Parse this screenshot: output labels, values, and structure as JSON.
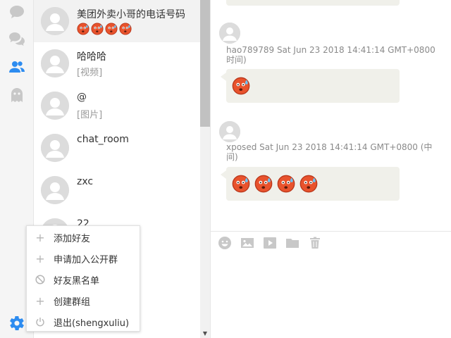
{
  "colors": {
    "accent": "#2d8cf0",
    "rail_icon": "#c8c8c8",
    "active_item_bg": "#f2f2f2",
    "bubble_bg": "#f0f0ea",
    "gear": "#2d8cf0"
  },
  "rail": {
    "icons": [
      "chat-bubble-icon",
      "group-chat-icon",
      "contacts-icon",
      "ghost-icon"
    ],
    "settings_icon": "gear-icon"
  },
  "conversations": [
    {
      "name": "美团外卖小哥的电话号码",
      "preview": "",
      "emoji_count": 4,
      "active": true
    },
    {
      "name": "哈哈哈",
      "preview": "[视频]"
    },
    {
      "name": "@",
      "preview": "[图片]"
    },
    {
      "name": "chat_room",
      "preview": ""
    },
    {
      "name": "zxc",
      "preview": ""
    },
    {
      "name": "22",
      "preview": ""
    }
  ],
  "messages": [
    {
      "sender": "hao789789",
      "time": "Sat Jun 23 2018 14:41:14 GMT+0800",
      "time_cont": "时间)",
      "emoji_count": 1
    },
    {
      "sender": "xposed",
      "time": "Sat Jun 23 2018 14:41:14 GMT+0800 (中",
      "time_cont": "间)",
      "emoji_count": 4
    }
  ],
  "toolbar": {
    "icons": [
      "emoji-icon",
      "image-icon",
      "video-icon",
      "folder-icon",
      "trash-icon"
    ]
  },
  "menu": {
    "items": [
      {
        "label": "添加好友",
        "icon": "plus-icon"
      },
      {
        "label": "申请加入公开群",
        "icon": "plus-icon"
      },
      {
        "label": "好友黑名单",
        "icon": "ban-icon"
      },
      {
        "label": "创建群组",
        "icon": "plus-icon"
      },
      {
        "label": "退出(shengxuliu)",
        "icon": "power-icon"
      }
    ]
  }
}
